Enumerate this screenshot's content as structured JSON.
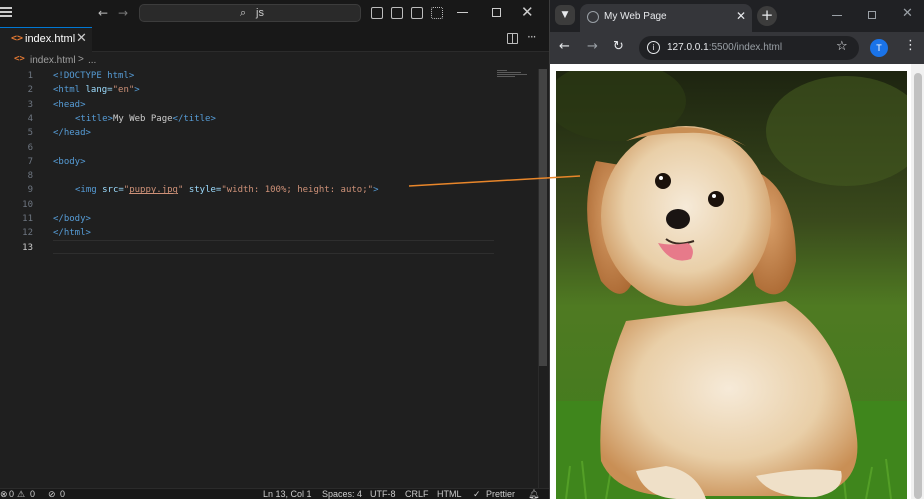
{
  "vscode": {
    "command_center": {
      "text": "js"
    },
    "tab": {
      "icon": "<>",
      "label": "index.html"
    },
    "breadcrumb": {
      "icon": "<>",
      "file": "index.html",
      "separator": ">",
      "more": "..."
    },
    "line_numbers": [
      "1",
      "2",
      "3",
      "4",
      "5",
      "6",
      "7",
      "8",
      "9",
      "10",
      "11",
      "12",
      "13"
    ],
    "active_line": "13",
    "status": {
      "errors": "0",
      "warnings": "0",
      "ports": "0",
      "position": "Ln 13, Col 1",
      "spaces": "Spaces: 4",
      "encoding": "UTF-8",
      "eol": "CRLF",
      "language": "HTML",
      "formatter": "Prettier"
    }
  },
  "code": {
    "doctype": "<!DOCTYPE html>",
    "html_open_tag": "<html",
    "lang_attr": " lang=",
    "lang_val": "\"en\"",
    "html_open_close": ">",
    "head_open": "<head>",
    "title_open": "<title>",
    "title_text": "My Web Page",
    "title_close": "</title>",
    "head_close": "</head>",
    "body_open": "<body>",
    "img_tag": "<img",
    "src_attr": " src=",
    "src_q1": "\"",
    "src_val": "puppy.jpg",
    "src_q2": "\"",
    "style_attr": " style=",
    "style_val": "\"width: 100%; height: auto;\"",
    "img_close": ">",
    "body_close": "</body>",
    "html_close": "</html>"
  },
  "browser": {
    "tab_title": "My Web Page",
    "url_host": "127.0.0.1",
    "url_rest": ":5500/index.html",
    "profile_initial": "T"
  },
  "colors": {
    "accent": "#0078d4",
    "html_icon": "#e37933",
    "annotation": "#e8862a",
    "profile": "#1a73e8"
  }
}
